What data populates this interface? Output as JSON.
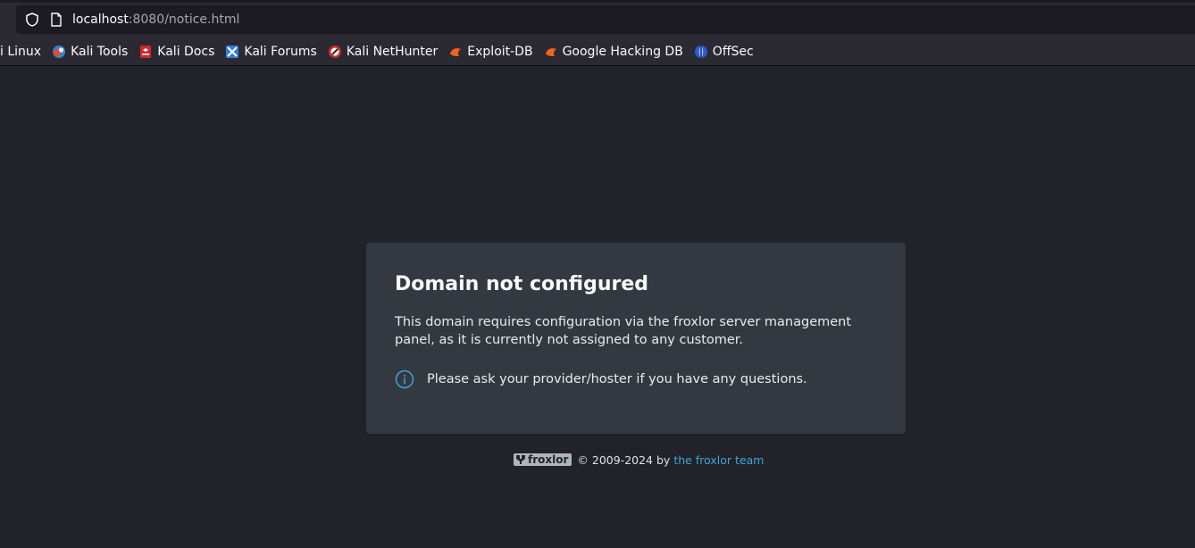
{
  "browser": {
    "url_host": "localhost",
    "url_rest": ":8080/notice.html",
    "bookmarks": [
      {
        "label": "i Linux",
        "icon": "kali-linux-icon"
      },
      {
        "label": "Kali Tools",
        "icon": "kali-tools-icon"
      },
      {
        "label": "Kali Docs",
        "icon": "kali-docs-icon"
      },
      {
        "label": "Kali Forums",
        "icon": "kali-forums-icon"
      },
      {
        "label": "Kali NetHunter",
        "icon": "kali-nethunter-icon"
      },
      {
        "label": "Exploit-DB",
        "icon": "exploit-db-icon"
      },
      {
        "label": "Google Hacking DB",
        "icon": "google-hacking-db-icon"
      },
      {
        "label": "OffSec",
        "icon": "offsec-icon"
      }
    ]
  },
  "notice": {
    "title": "Domain not configured",
    "description": "This domain requires configuration via the froxlor server management panel, as it is currently not assigned to any customer.",
    "info": "Please ask your provider/hoster if you have any questions."
  },
  "footer": {
    "logo_text": "froxlor",
    "copyright": "© 2009-2024 by",
    "team_link": "the froxlor team"
  },
  "colors": {
    "background": "#212328",
    "card": "#343841",
    "link": "#3fa4d8"
  }
}
